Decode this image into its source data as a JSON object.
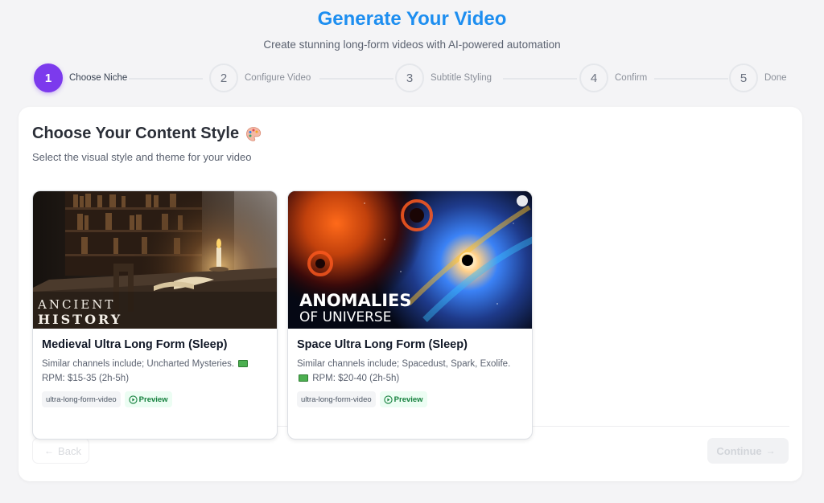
{
  "header": {
    "title": "Generate Your Video",
    "subtitle": "Create stunning long-form videos with AI-powered automation"
  },
  "steps": [
    {
      "number": "1",
      "label": "Choose Niche",
      "active": true
    },
    {
      "number": "2",
      "label": "Configure Video",
      "active": false
    },
    {
      "number": "3",
      "label": "Subtitle Styling",
      "active": false
    },
    {
      "number": "4",
      "label": "Confirm",
      "active": false
    },
    {
      "number": "5",
      "label": "Done",
      "active": false
    }
  ],
  "content": {
    "title": "Choose Your Content Style",
    "subtitle": "Select the visual style and theme for your video"
  },
  "niches": [
    {
      "title": "Medieval Ultra Long Form (Sleep)",
      "thumb_text_line1": "ANCIENT",
      "thumb_text_line2": "HISTORY",
      "desc_a": "Similar channels include; Uncharted Mysteries.",
      "desc_b": "RPM: $15-35 (2h-5h)",
      "tag": "ultra-long-form-video",
      "preview": "Preview"
    },
    {
      "title": "Space Ultra Long Form (Sleep)",
      "thumb_text_line1": "ANOMALIES",
      "thumb_text_line2": "OF UNIVERSE",
      "desc_a": "Similar channels include; Spacedust, Spark, Exolife.",
      "desc_b": "RPM: $20-40 (2h-5h)",
      "tag": "ultra-long-form-video",
      "preview": "Preview"
    }
  ],
  "nav": {
    "back": "Back",
    "continue": "Continue"
  },
  "colors": {
    "accent": "#1d8ef0",
    "step_active": "#7c3aed",
    "preview_green": "#15803d"
  },
  "icons": [
    "palette-icon",
    "play-icon",
    "money-icon",
    "arrow-left-icon",
    "arrow-right-icon"
  ]
}
